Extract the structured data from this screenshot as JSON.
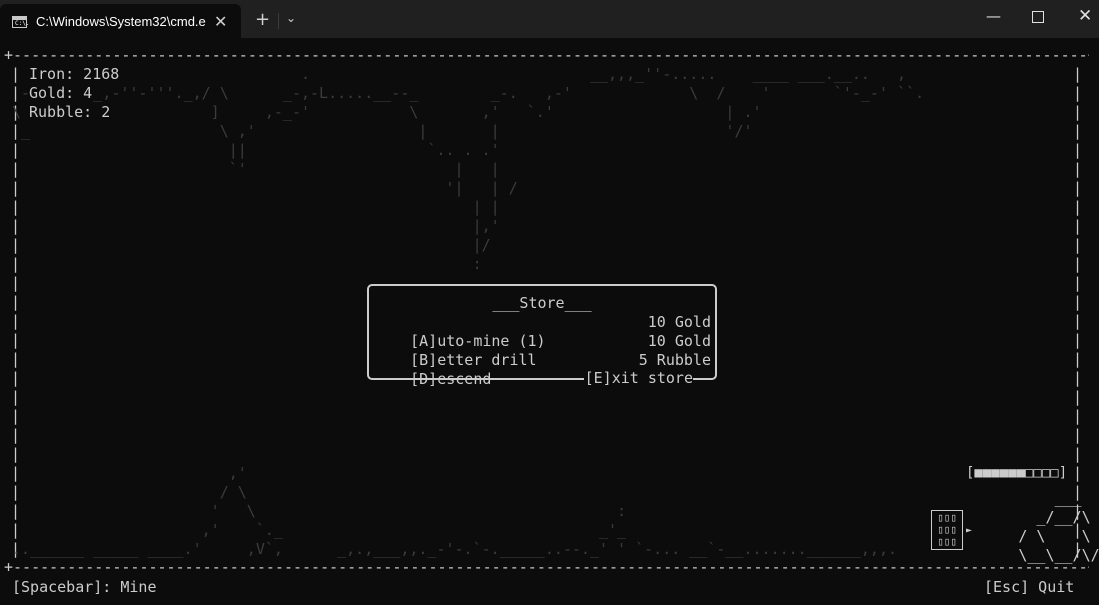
{
  "window": {
    "tab_title": "C:\\Windows\\System32\\cmd.e",
    "tab_icon_text": "C:\\.",
    "close_tab": "✕",
    "new_tab": "+",
    "dropdown": "⌄",
    "minimize": "—",
    "close": "✕"
  },
  "hud": {
    "iron": "Iron: 2168",
    "gold": "Gold: 4",
    "rubble": "Rubble: 2"
  },
  "frame": {
    "top": "+-----------------------------------------------------------------------------------------------------------------------+",
    "bottom": "+-----------------------------------------------------------------------------------------------------------------------+",
    "side": "|"
  },
  "progress": "[■■■■■■□□□□]",
  "store": {
    "title": "___Store___",
    "items": [
      {
        "label": "[A]uto-mine (1)",
        "cost": "10 Gold"
      },
      {
        "label": "[B]etter drill",
        "cost": "10 Gold"
      },
      {
        "label": "[D]escend",
        "cost": "5 Rubble"
      }
    ],
    "exit": "[E]xit store"
  },
  "footer": {
    "mine": "[Spacebar]: Mine",
    "quit": "[Esc] Quit"
  },
  "art": {
    "terrain_top": [
      "        _                       .                               __,,,_''-.....    ____ ___.__..   ,  ",
      " - '     _,-''-'''._,/ \\      _-,-L.....__--_        _-.   ,-'             \\  /    '       `'-_-' ``.",
      "\\ ,'                  ]     ,-_-'           \\       ,'   `.'                   | .'                 ",
      " _                     \\ ,'                  |       |                         '/'                  ",
      "                        ||                    `.. . .'                                              ",
      "                        `'                       |   |                                              ",
      "                                                '|   | /                                            ",
      "                                                   | |                                              ",
      "                                                   |,'                                              ",
      "                                                   |/                                               ",
      "                                                   :                                                "
    ],
    "terrain_bottom": [
      "                        ,'                                                                           ",
      "                       / \\                                                                           ",
      "                      '   \\                                        :                                 ",
      "                     ,'    `._                                   _'_                                ",
      "..______ _____ ____.'     ,V`,      _,.,___,,._-'-.`-._____..--._' ' `-... __`-__.......______,,,.  "
    ],
    "mine_cart": [
      "                ___  ",
      "              _/__/\\ ",
      "            / \\    \\ \\",
      "            \\__\\__/\\/"
    ],
    "door": "▯▯▯\n▯▯▯\n▯▯▯",
    "arrow": "►"
  }
}
